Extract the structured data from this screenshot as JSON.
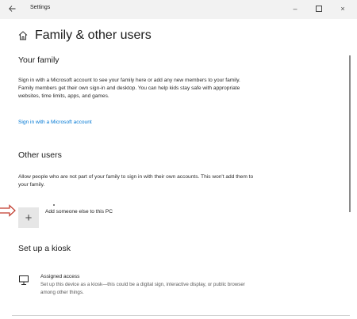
{
  "window": {
    "title": "Settings",
    "back_icon": "back-arrow-icon",
    "controls": {
      "minimize": "–",
      "close": "×"
    }
  },
  "header": {
    "icon": "home-icon",
    "title": "Family & other users"
  },
  "your_family": {
    "title": "Your family",
    "description": "Sign in with a Microsoft account to see your family here or add any new members to your family. Family members get their own sign-in and desktop. You can help kids stay safe with appropriate websites, time limits, apps, and games.",
    "link": "Sign in with a Microsoft account"
  },
  "other_users": {
    "title": "Other users",
    "description": "Allow people who are not part of your family to sign in with their own accounts. This won't add them to your family.",
    "add_label": "Add someone else to this PC",
    "add_glyph": "+"
  },
  "kiosk": {
    "title": "Set up a kiosk",
    "item_title": "Assigned access",
    "item_description": "Set up this device as a kiosk—this could be a digital sign, interactive display, or public browser among other things.",
    "icon": "kiosk-monitor-icon"
  },
  "colors": {
    "accent": "#0078d4",
    "annotation_arrow": "#c0392b"
  }
}
